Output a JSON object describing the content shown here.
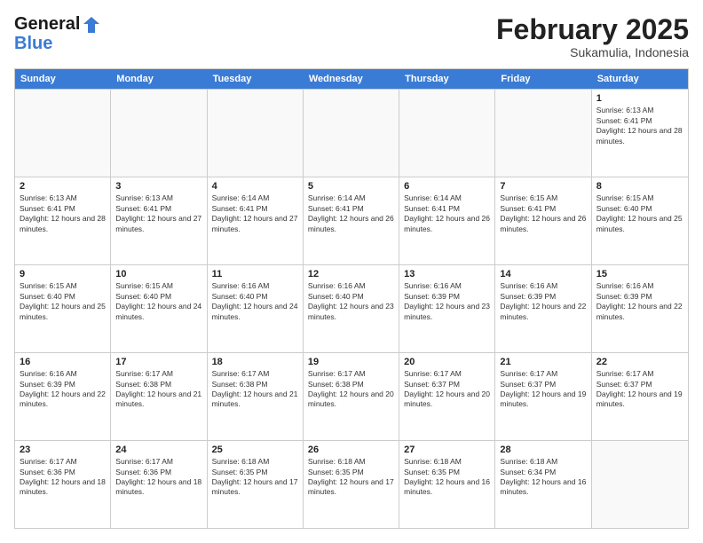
{
  "header": {
    "logo_general": "General",
    "logo_blue": "Blue",
    "month_title": "February 2025",
    "location": "Sukamulia, Indonesia"
  },
  "weekdays": [
    "Sunday",
    "Monday",
    "Tuesday",
    "Wednesday",
    "Thursday",
    "Friday",
    "Saturday"
  ],
  "weeks": [
    [
      {
        "day": "",
        "empty": true
      },
      {
        "day": "",
        "empty": true
      },
      {
        "day": "",
        "empty": true
      },
      {
        "day": "",
        "empty": true
      },
      {
        "day": "",
        "empty": true
      },
      {
        "day": "",
        "empty": true
      },
      {
        "day": "1",
        "rise": "6:13 AM",
        "set": "6:41 PM",
        "daylight": "12 hours and 28 minutes."
      }
    ],
    [
      {
        "day": "2",
        "rise": "6:13 AM",
        "set": "6:41 PM",
        "daylight": "12 hours and 28 minutes."
      },
      {
        "day": "3",
        "rise": "6:13 AM",
        "set": "6:41 PM",
        "daylight": "12 hours and 27 minutes."
      },
      {
        "day": "4",
        "rise": "6:14 AM",
        "set": "6:41 PM",
        "daylight": "12 hours and 27 minutes."
      },
      {
        "day": "5",
        "rise": "6:14 AM",
        "set": "6:41 PM",
        "daylight": "12 hours and 26 minutes."
      },
      {
        "day": "6",
        "rise": "6:14 AM",
        "set": "6:41 PM",
        "daylight": "12 hours and 26 minutes."
      },
      {
        "day": "7",
        "rise": "6:15 AM",
        "set": "6:41 PM",
        "daylight": "12 hours and 26 minutes."
      },
      {
        "day": "8",
        "rise": "6:15 AM",
        "set": "6:40 PM",
        "daylight": "12 hours and 25 minutes."
      }
    ],
    [
      {
        "day": "9",
        "rise": "6:15 AM",
        "set": "6:40 PM",
        "daylight": "12 hours and 25 minutes."
      },
      {
        "day": "10",
        "rise": "6:15 AM",
        "set": "6:40 PM",
        "daylight": "12 hours and 24 minutes."
      },
      {
        "day": "11",
        "rise": "6:16 AM",
        "set": "6:40 PM",
        "daylight": "12 hours and 24 minutes."
      },
      {
        "day": "12",
        "rise": "6:16 AM",
        "set": "6:40 PM",
        "daylight": "12 hours and 23 minutes."
      },
      {
        "day": "13",
        "rise": "6:16 AM",
        "set": "6:39 PM",
        "daylight": "12 hours and 23 minutes."
      },
      {
        "day": "14",
        "rise": "6:16 AM",
        "set": "6:39 PM",
        "daylight": "12 hours and 22 minutes."
      },
      {
        "day": "15",
        "rise": "6:16 AM",
        "set": "6:39 PM",
        "daylight": "12 hours and 22 minutes."
      }
    ],
    [
      {
        "day": "16",
        "rise": "6:16 AM",
        "set": "6:39 PM",
        "daylight": "12 hours and 22 minutes."
      },
      {
        "day": "17",
        "rise": "6:17 AM",
        "set": "6:38 PM",
        "daylight": "12 hours and 21 minutes."
      },
      {
        "day": "18",
        "rise": "6:17 AM",
        "set": "6:38 PM",
        "daylight": "12 hours and 21 minutes."
      },
      {
        "day": "19",
        "rise": "6:17 AM",
        "set": "6:38 PM",
        "daylight": "12 hours and 20 minutes."
      },
      {
        "day": "20",
        "rise": "6:17 AM",
        "set": "6:37 PM",
        "daylight": "12 hours and 20 minutes."
      },
      {
        "day": "21",
        "rise": "6:17 AM",
        "set": "6:37 PM",
        "daylight": "12 hours and 19 minutes."
      },
      {
        "day": "22",
        "rise": "6:17 AM",
        "set": "6:37 PM",
        "daylight": "12 hours and 19 minutes."
      }
    ],
    [
      {
        "day": "23",
        "rise": "6:17 AM",
        "set": "6:36 PM",
        "daylight": "12 hours and 18 minutes."
      },
      {
        "day": "24",
        "rise": "6:17 AM",
        "set": "6:36 PM",
        "daylight": "12 hours and 18 minutes."
      },
      {
        "day": "25",
        "rise": "6:18 AM",
        "set": "6:35 PM",
        "daylight": "12 hours and 17 minutes."
      },
      {
        "day": "26",
        "rise": "6:18 AM",
        "set": "6:35 PM",
        "daylight": "12 hours and 17 minutes."
      },
      {
        "day": "27",
        "rise": "6:18 AM",
        "set": "6:35 PM",
        "daylight": "12 hours and 16 minutes."
      },
      {
        "day": "28",
        "rise": "6:18 AM",
        "set": "6:34 PM",
        "daylight": "12 hours and 16 minutes."
      },
      {
        "day": "",
        "empty": true
      }
    ]
  ]
}
